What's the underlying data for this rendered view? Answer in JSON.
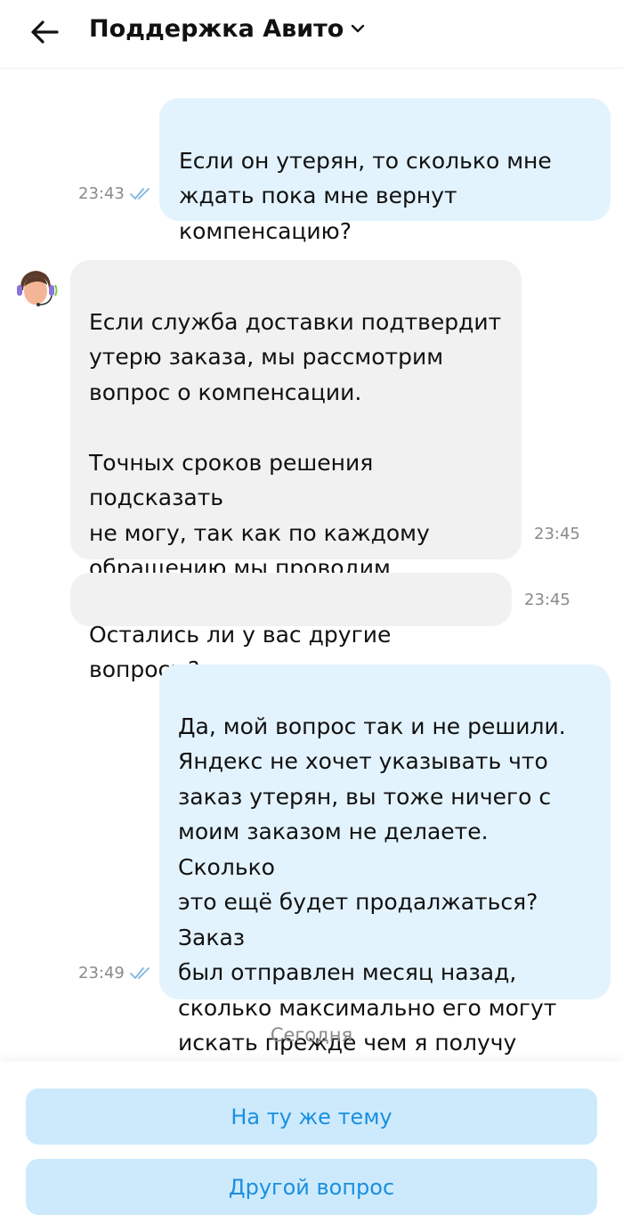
{
  "header": {
    "title": "Поддержка Авито",
    "back_icon": "arrow-left-icon",
    "dropdown_icon": "chevron-down-icon"
  },
  "messages": [
    {
      "direction": "outgoing",
      "text": "Если он утерян, то сколько мне\nждать пока мне вернут\nкомпенсацию?",
      "time": "23:43",
      "status_icon": "double-check-icon"
    },
    {
      "direction": "incoming",
      "text": "Если служба доставки подтвердит\nутерю заказа, мы рассмотрим\nвопрос о компенсации.\n\nТочных сроков решения подсказать\nне могу, так как по каждому\nобращению мы проводим\nиндивидуальную работу.",
      "time": "23:45",
      "avatar_icon": "support-agent-avatar-icon"
    },
    {
      "direction": "incoming",
      "text": "Остались ли у вас другие вопросы?",
      "time": "23:45"
    },
    {
      "direction": "outgoing",
      "text": "Да, мой вопрос так и не решили.\nЯндекс не хочет указывать что\nзаказ утерян, вы тоже ничего с\nмоим заказом не делаете. Сколько\nэто ещё будет продалжаться? Заказ\nбыл отправлен месяц назад,\nсколько максимально его могут\nискать прежде чем я получу\nкомпенсацию?",
      "time": "23:49",
      "status_icon": "double-check-icon"
    }
  ],
  "date_separator": "Сегодня",
  "actions": [
    {
      "label": "На ту же тему"
    },
    {
      "label": "Другой вопрос"
    }
  ],
  "colors": {
    "outgoing_bubble": "#e3f3fd",
    "incoming_bubble": "#f1f1f1",
    "action_button_bg": "#cdeafc",
    "action_button_text": "#1a8fe0",
    "read_ticks": "#7fb6e0",
    "timestamp": "#8a8a8a"
  }
}
